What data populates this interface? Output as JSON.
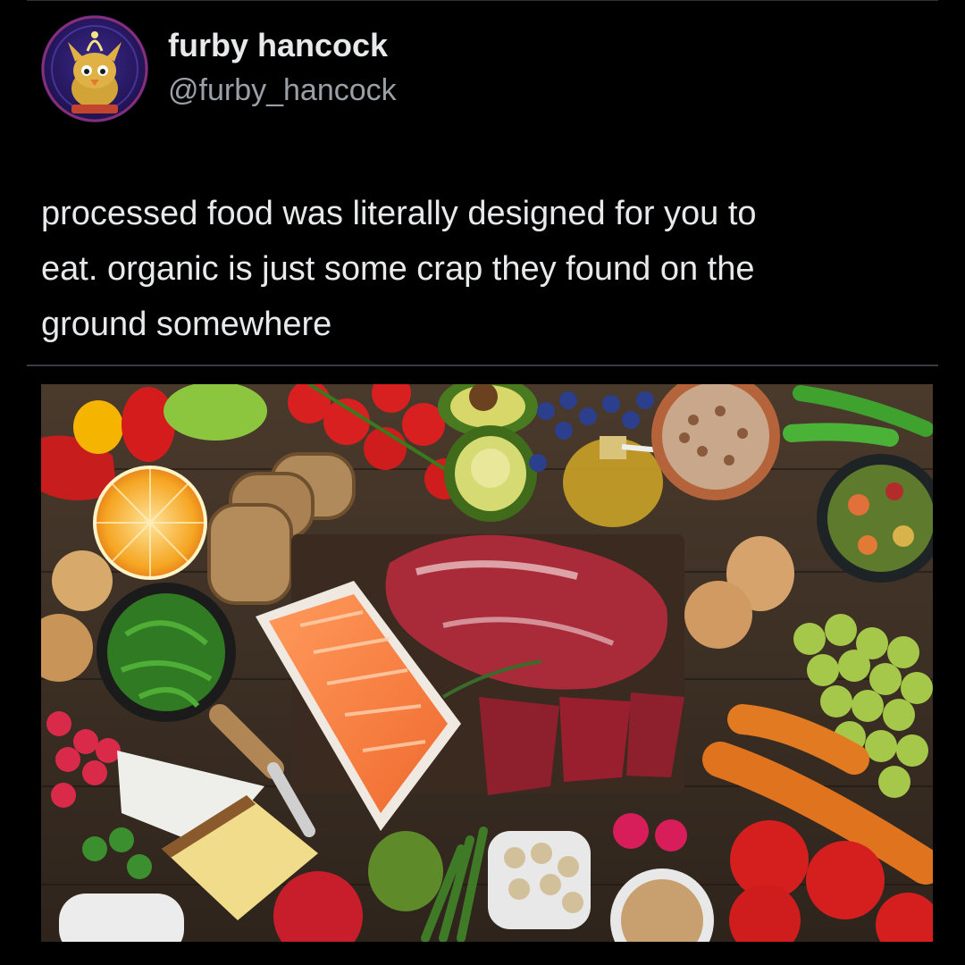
{
  "tweet": {
    "display_name": "furby hancock",
    "handle": "@furby_hancock",
    "lines": [
      "processed food was literally designed for you to",
      "eat. organic is just some crap they found on the",
      "ground somewhere"
    ]
  },
  "media": {
    "alt_icon": "food-spread-photo"
  },
  "colors": {
    "background": "#000000",
    "text": "#e7e9ea",
    "handle": "#9aa0a6",
    "divider": "#3a3d40"
  }
}
